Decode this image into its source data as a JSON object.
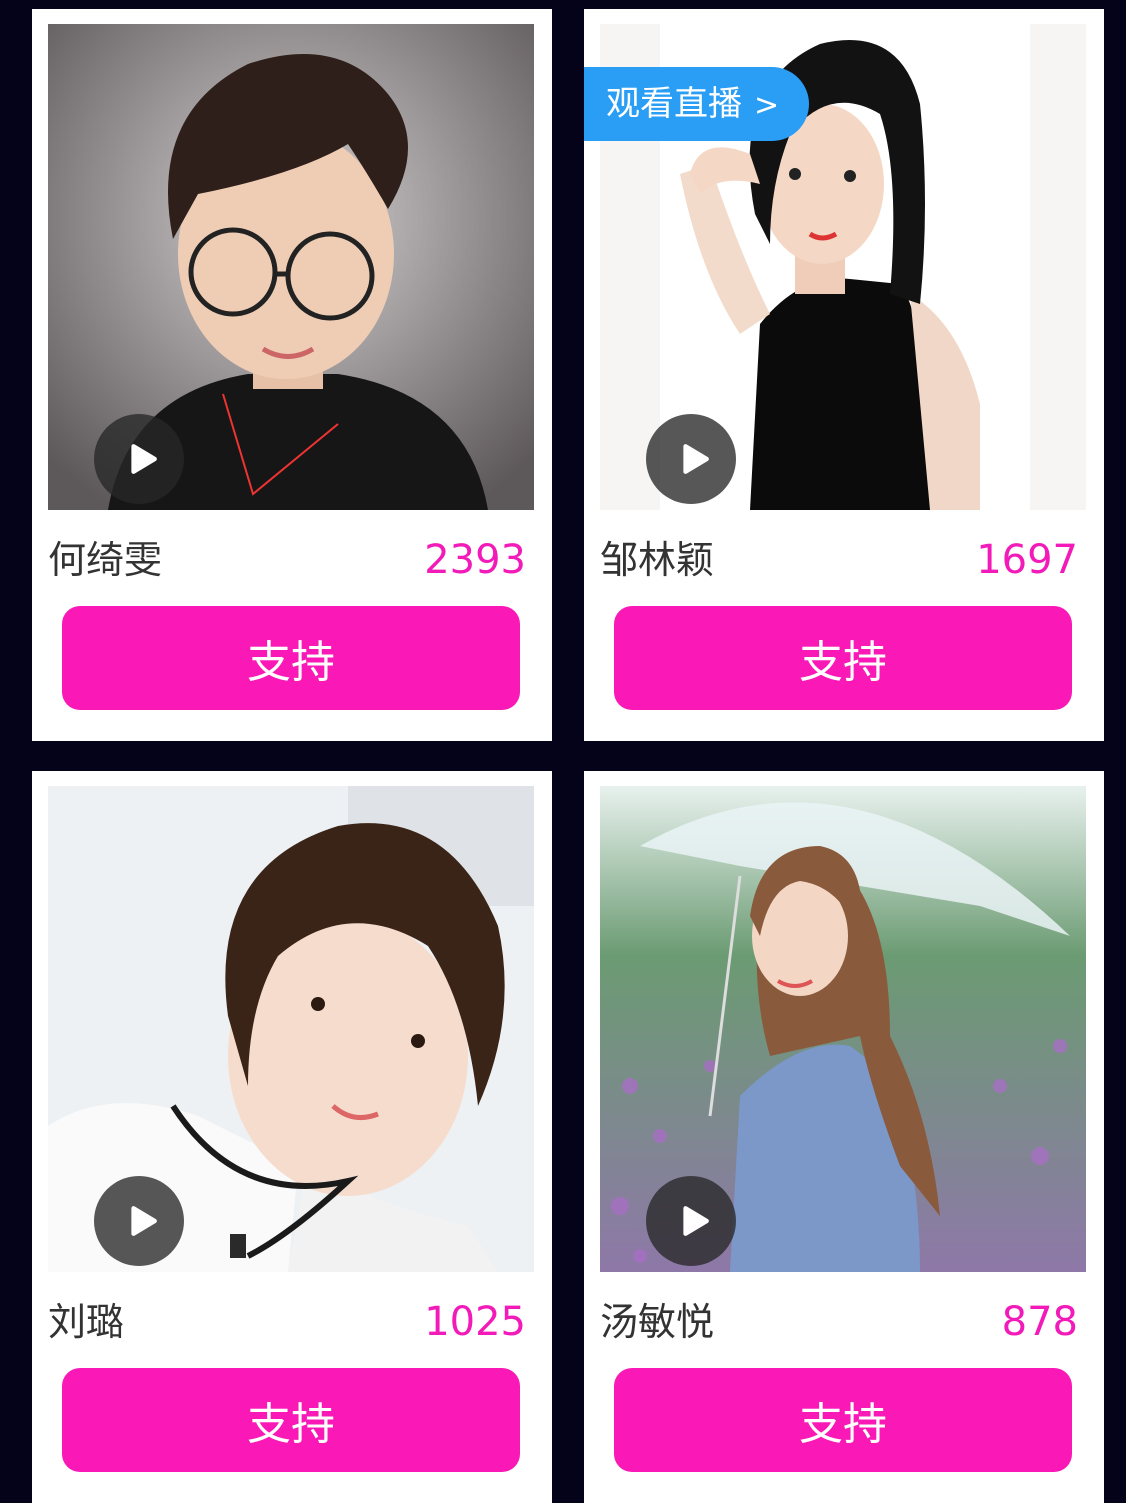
{
  "colors": {
    "background": "#04031a",
    "accent": "#fa18b6",
    "votes": "#f21ab9",
    "live_tag": "#2a9df4"
  },
  "live_tag": {
    "label": "观看直播",
    "arrow": ">"
  },
  "support_label": "支持",
  "contestants": [
    {
      "name": "何绮雯",
      "votes": "2393",
      "photo_icon": "portrait-photo"
    },
    {
      "name": "邹林颖",
      "votes": "1697",
      "photo_icon": "portrait-photo"
    },
    {
      "name": "刘璐",
      "votes": "1025",
      "photo_icon": "portrait-photo"
    },
    {
      "name": "汤敏悦",
      "votes": "878",
      "photo_icon": "portrait-photo"
    }
  ]
}
